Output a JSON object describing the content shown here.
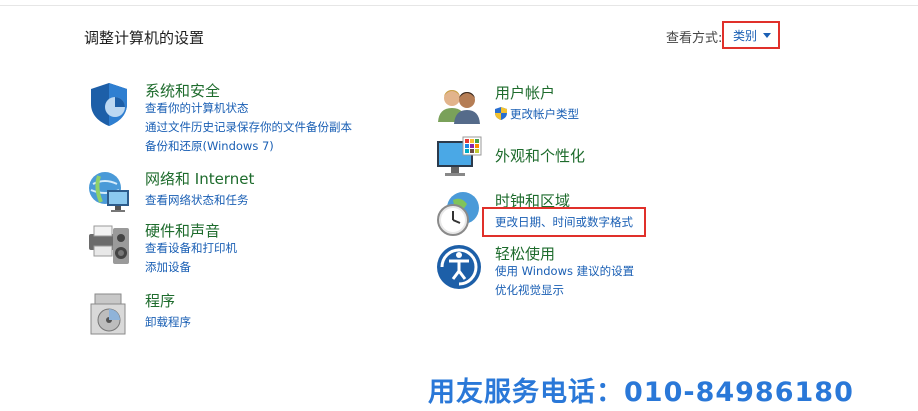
{
  "page": {
    "title": "调整计算机的设置"
  },
  "view_by": {
    "label": "查看方式:",
    "value": "类别"
  },
  "left_categories": [
    {
      "title": "系统和安全",
      "icon": "shield-icon",
      "links": [
        "查看你的计算机状态",
        "通过文件历史记录保存你的文件备份副本",
        "备份和还原(Windows 7)"
      ]
    },
    {
      "title": "网络和 Internet",
      "icon": "network-globe-icon",
      "links": [
        "查看网络状态和任务"
      ]
    },
    {
      "title": "硬件和声音",
      "icon": "printer-speaker-icon",
      "links": [
        "查看设备和打印机",
        "添加设备"
      ]
    },
    {
      "title": "程序",
      "icon": "programs-disc-icon",
      "links": [
        "卸载程序"
      ]
    }
  ],
  "right_categories": [
    {
      "title": "用户帐户",
      "icon": "users-icon",
      "links": [
        "更改帐户类型"
      ]
    },
    {
      "title": "外观和个性化",
      "icon": "monitor-palette-icon",
      "links": []
    },
    {
      "title": "时钟和区域",
      "icon": "clock-globe-icon",
      "links": [
        "更改日期、时间或数字格式"
      ]
    },
    {
      "title": "轻松使用",
      "icon": "ease-of-access-icon",
      "links": [
        "使用 Windows 建议的设置",
        "优化视觉显示"
      ]
    }
  ],
  "footer": {
    "phone": "用友服务电话：010-84986180"
  },
  "colors": {
    "title_green": "#1d6b2c",
    "link_blue": "#1a5fb4",
    "highlight_red": "#e0302a",
    "footer_blue": "#2a78d8"
  }
}
